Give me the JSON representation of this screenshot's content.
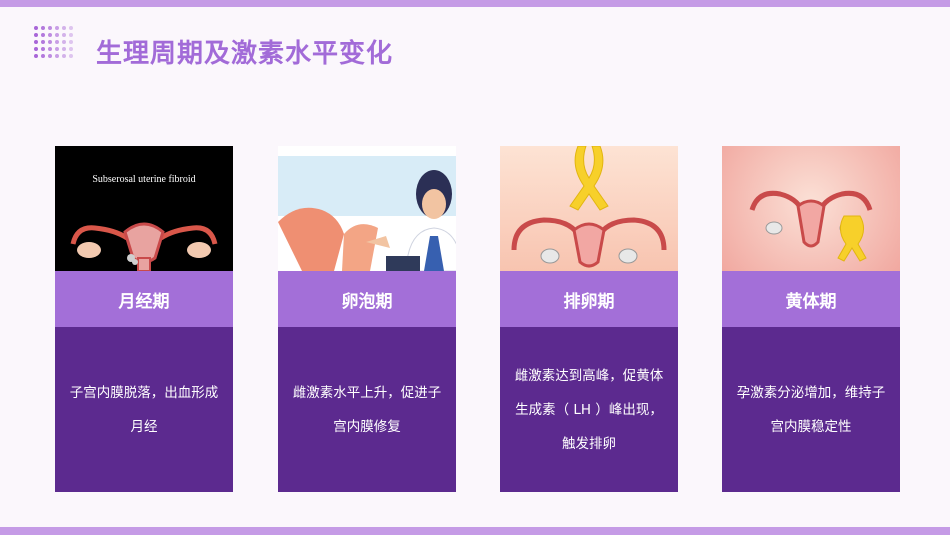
{
  "title": "生理周期及激素水平变化",
  "accent_color": "#a36fd8",
  "dark_color": "#5c2a8f",
  "cards": [
    {
      "label": "月经期",
      "image_caption": "Subserosal uterine fibroid",
      "image_icon": "uterus-fibroid-illustration",
      "description": "子宫内膜脱落，出血形成月经"
    },
    {
      "label": "卵泡期",
      "image_icon": "doctor-uterus-illustration",
      "description": "雌激素水平上升，促进子宫内膜修复"
    },
    {
      "label": "排卵期",
      "image_icon": "yellow-ribbon-uterus-illustration",
      "description": "雌激素达到高峰，促黄体生成素（ LH ）峰出现，触发排卵"
    },
    {
      "label": "黄体期",
      "image_icon": "uterus-ribbon-illustration",
      "description": "孕激素分泌增加，维持子宫内膜稳定性"
    }
  ]
}
